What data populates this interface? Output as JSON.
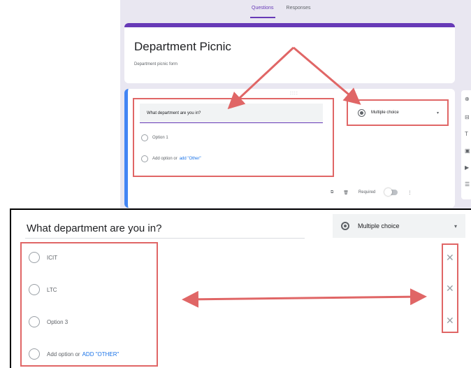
{
  "tabs": [
    {
      "label": "Questions",
      "active": true
    },
    {
      "label": "Responses",
      "active": false
    }
  ],
  "form": {
    "title": "Department Picnic",
    "description": "Department picnic form"
  },
  "question_card": {
    "question": "What department are you in?",
    "options": [
      "Option 1"
    ],
    "add_option_text": "Add option or",
    "add_other_text": "add \"Other\"",
    "type_label": "Multiple choice",
    "required_label": "Required",
    "drag_handle": "::::"
  },
  "zoom": {
    "question": "What department are you in?",
    "type_label": "Multiple choice",
    "options": [
      "ICIT",
      "LTC",
      "Option 3"
    ],
    "add_option_text": "Add option or",
    "add_other_text": "ADD \"OTHER\""
  },
  "icons": {
    "copy": "copy-icon",
    "delete": "trash-icon",
    "more": "more-vert-icon",
    "close": "close-icon"
  },
  "colors": {
    "accent": "#673ab7",
    "highlight": "#e06666",
    "link": "#1a73e8",
    "active_card_border": "#4285f4"
  }
}
